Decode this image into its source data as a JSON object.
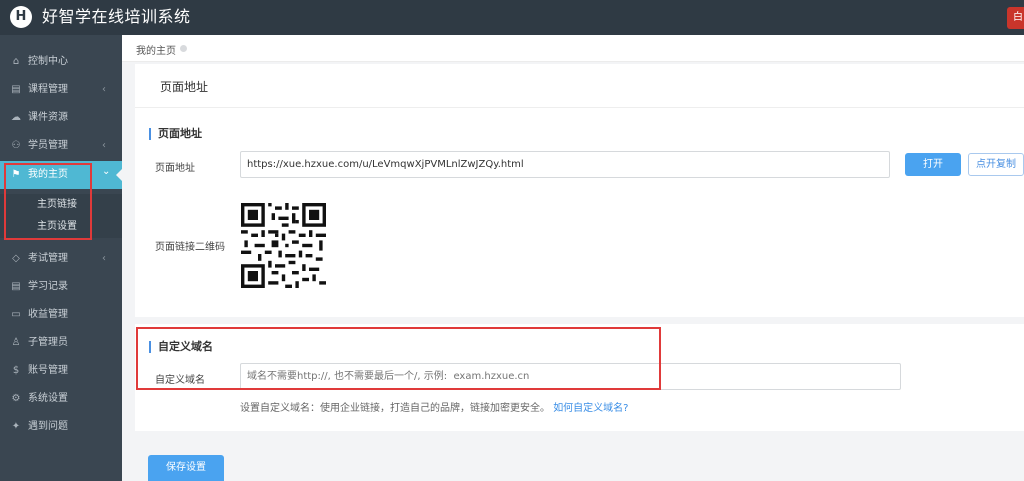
{
  "app": {
    "logo_letter": "H",
    "title": "好智学在线培训系统",
    "top_right_label": "白"
  },
  "sidebar": {
    "items": [
      {
        "label": "控制中心",
        "icon": "home-icon"
      },
      {
        "label": "课程管理",
        "icon": "book-icon",
        "has_arrow": true
      },
      {
        "label": "课件资源",
        "icon": "cloud-icon"
      },
      {
        "label": "学员管理",
        "icon": "users-icon",
        "has_arrow": true
      },
      {
        "label": "我的主页",
        "icon": "flag-icon",
        "active": true
      },
      {
        "label": "考试管理",
        "icon": "tag-icon",
        "has_arrow": true
      },
      {
        "label": "学习记录",
        "icon": "notebook-icon"
      },
      {
        "label": "收益管理",
        "icon": "card-icon"
      },
      {
        "label": "子管理员",
        "icon": "admin-icon"
      },
      {
        "label": "账号管理",
        "icon": "dollar-icon"
      },
      {
        "label": "系统设置",
        "icon": "gear-icon"
      },
      {
        "label": "遇到问题",
        "icon": "help-icon"
      }
    ],
    "subitems": [
      {
        "label": "主页链接"
      },
      {
        "label": "主页设置"
      }
    ],
    "arrow_left": "‹",
    "arrow_down": "⌄"
  },
  "breadcrumb": {
    "current": "我的主页"
  },
  "page_address_card": {
    "header_title": "页面地址",
    "section_title": "页面地址",
    "url_label": "页面地址",
    "url_value": "https://xue.hzxue.com/u/LeVmqwXjPVMLnlZwJZQy.html",
    "open_button": "打开",
    "copy_button": "点开复制",
    "qr_label": "页面链接二维码"
  },
  "custom_domain_card": {
    "section_title": "自定义域名",
    "domain_label": "自定义域名",
    "domain_placeholder": "域名不需要http://, 也不需要最后一个/, 示例:  exam.hzxue.cn",
    "hint_text": "设置自定义域名：使用企业链接，打造自己的品牌，链接加密更安全。",
    "hint_link": "如何自定义域名?"
  },
  "save_button": "保存设置",
  "colors": {
    "topbar": "#2f3a44",
    "sidebar": "#3a4651",
    "active": "#4fb8d3",
    "primary": "#4aa3f0",
    "annotation_red": "#e03a3a"
  }
}
